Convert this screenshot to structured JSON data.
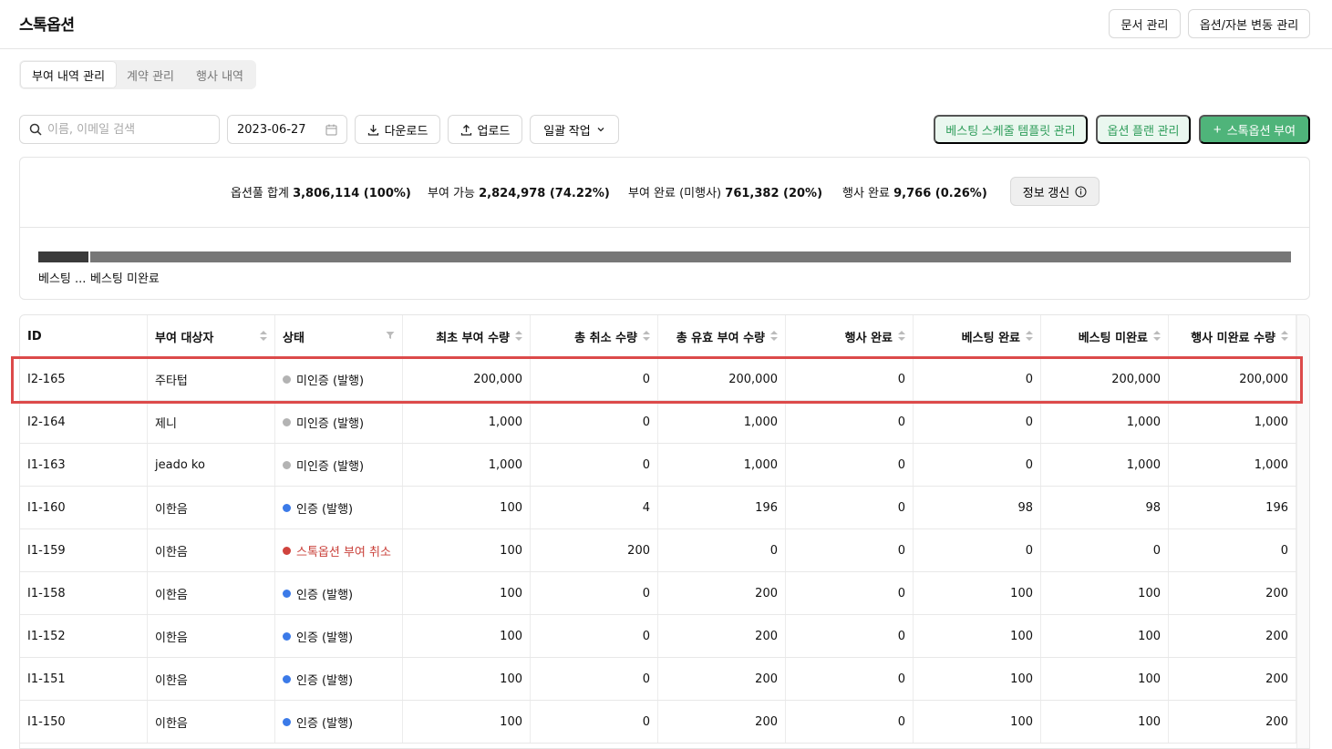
{
  "header": {
    "title": "스톡옵션",
    "doc_btn": "문서 관리",
    "cap_btn": "옵션/자본 변동 관리"
  },
  "tabs": [
    "부여 내역 관리",
    "계약 관리",
    "행사 내역"
  ],
  "toolbar": {
    "search_placeholder": "이름, 이메일 검색",
    "date": "2023-06-27",
    "download": "다운로드",
    "upload": "업로드",
    "bulk": "일괄 작업",
    "vest_template": "베스팅 스케줄 템플릿 관리",
    "option_plan": "옵션 플랜 관리",
    "grant": "스톡옵션 부여"
  },
  "summary": {
    "pool_label": "옵션풀 합계",
    "pool_value": "3,806,114 (100%)",
    "avail_label": "부여 가능",
    "avail_value": "2,824,978 (74.22%)",
    "granted_label": "부여 완료 (미행사)",
    "granted_value": "761,382 (20%)",
    "exercised_label": "행사 완료",
    "exercised_value": "9,766 (0.26%)",
    "refresh": "정보 갱신",
    "bar_vested_label": "베스팅 ...",
    "bar_unvested_label": "베스팅 미완료"
  },
  "table": {
    "columns": [
      "ID",
      "부여 대상자",
      "상태",
      "최초 부여 수량",
      "총 취소 수량",
      "총 유효 부여 수량",
      "행사 완료",
      "베스팅 완료",
      "베스팅 미완료",
      "행사 미완료 수량"
    ],
    "rows": [
      [
        "I2-165",
        "주타텁",
        "미인증 (발행)",
        "200,000",
        "0",
        "200,000",
        "0",
        "0",
        "200,000",
        "200,000"
      ],
      [
        "I2-164",
        "제니",
        "미인증 (발행)",
        "1,000",
        "0",
        "1,000",
        "0",
        "0",
        "1,000",
        "1,000"
      ],
      [
        "I1-163",
        "jeado ko",
        "미인증 (발행)",
        "1,000",
        "0",
        "1,000",
        "0",
        "0",
        "1,000",
        "1,000"
      ],
      [
        "I1-160",
        "이한음",
        "인증 (발행)",
        "100",
        "4",
        "196",
        "0",
        "98",
        "98",
        "196"
      ],
      [
        "I1-159",
        "이한음",
        "스톡옵션 부여 취소",
        "100",
        "200",
        "0",
        "0",
        "0",
        "0",
        "0"
      ],
      [
        "I1-158",
        "이한음",
        "인증 (발행)",
        "100",
        "0",
        "200",
        "0",
        "100",
        "100",
        "200"
      ],
      [
        "I1-152",
        "이한음",
        "인증 (발행)",
        "100",
        "0",
        "200",
        "0",
        "100",
        "100",
        "200"
      ],
      [
        "I1-151",
        "이한음",
        "인증 (발행)",
        "100",
        "0",
        "200",
        "0",
        "100",
        "100",
        "200"
      ],
      [
        "I1-150",
        "이한음",
        "인증 (발행)",
        "100",
        "0",
        "200",
        "0",
        "100",
        "100",
        "200"
      ]
    ],
    "status_colors": {
      "미인증 (발행)": "#b3b3b3",
      "인증 (발행)": "#3b7ae8",
      "스톡옵션 부여 취소": "#d0433d"
    }
  },
  "colors": {
    "accent_green": "#4fb47a",
    "highlight": "#dc4a4a",
    "cancel_text": "#c9403a"
  }
}
